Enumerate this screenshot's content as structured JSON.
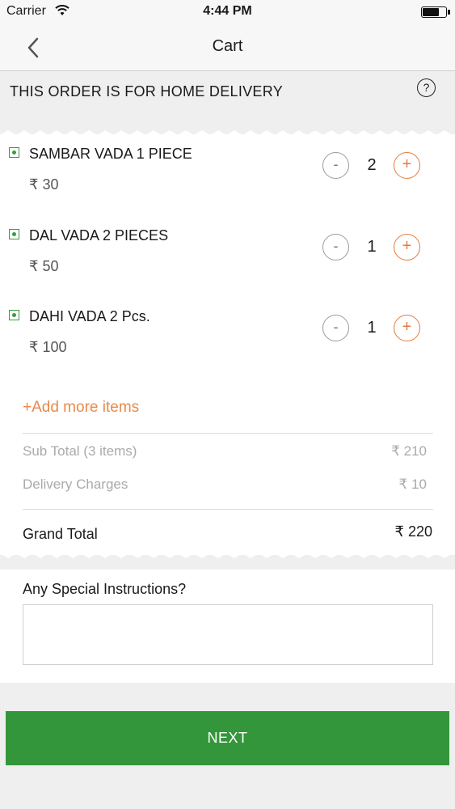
{
  "status_bar": {
    "carrier": "Carrier",
    "time": "4:44 PM",
    "battery_level": 0.7
  },
  "nav": {
    "title": "Cart",
    "back_icon": "chevron-left-icon"
  },
  "delivery": {
    "text": "THIS ORDER IS FOR HOME DELIVERY",
    "help_icon": "?"
  },
  "items": [
    {
      "name": "SAMBAR VADA 1 PIECE",
      "price": "₹ 30",
      "minus": "-",
      "qty": "2",
      "plus": "+"
    },
    {
      "name": "DAL VADA 2 PIECES",
      "price": "₹ 50",
      "minus": "-",
      "qty": "1",
      "plus": "+"
    },
    {
      "name": "DAHI VADA 2 Pcs.",
      "price": "₹ 100",
      "minus": "-",
      "qty": "1",
      "plus": "+"
    }
  ],
  "add_more": "+Add more items",
  "summary": {
    "subtotal_label": "Sub Total (3 items)",
    "subtotal_value": "₹ 210",
    "delivery_label": "Delivery Charges",
    "delivery_value": "₹ 10",
    "grand_label": "Grand Total",
    "grand_value": "₹ 220"
  },
  "instructions": {
    "label": "Any Special Instructions?",
    "value": "",
    "placeholder": ""
  },
  "next_button": "NEXT",
  "colors": {
    "accent_orange": "#e27b3d",
    "veg_green": "#3a9a3e",
    "button_green": "#34963a"
  }
}
